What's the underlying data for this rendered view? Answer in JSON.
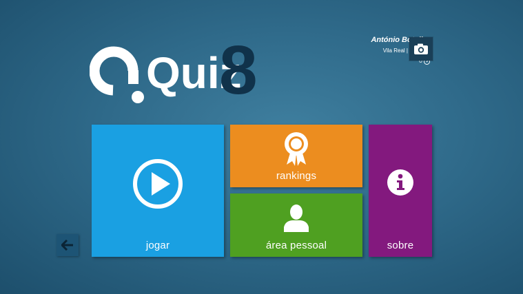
{
  "logo": {
    "word": "Quiz",
    "number": "8"
  },
  "user": {
    "name": "António Botelho",
    "location": "Vila Real | Portugal",
    "points": "0",
    "coin_symbol": "$"
  },
  "tiles": {
    "play": "jogar",
    "rankings": "rankings",
    "personal": "área pessoal",
    "about": "sobre"
  },
  "colors": {
    "play": "#1aa0e2",
    "rankings": "#ec8d1f",
    "personal": "#4fa021",
    "about": "#83197e",
    "background": "#2f6a8a"
  },
  "icons": {
    "camera": "camera-icon",
    "play": "play-icon",
    "rankings": "award-ribbon-icon",
    "personal": "user-silhouette-icon",
    "about": "info-icon",
    "back": "arrow-left-icon"
  }
}
